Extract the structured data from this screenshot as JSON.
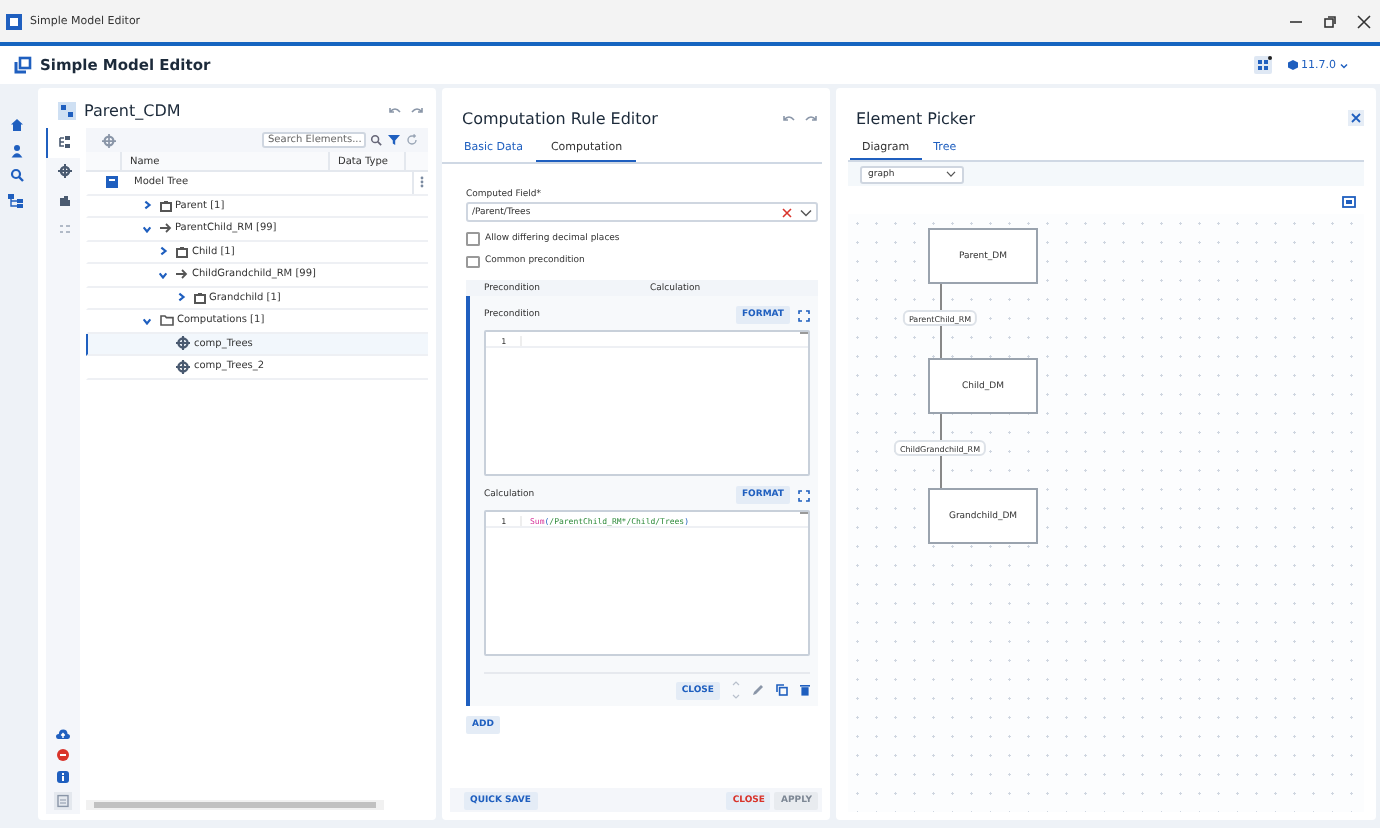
{
  "window": {
    "title": "Simple Model Editor"
  },
  "app_header": {
    "title": "Simple Model Editor",
    "version": "11.7.0"
  },
  "side_tabs": [
    {
      "selected": true
    },
    {
      "selected": false
    },
    {
      "selected": false
    },
    {
      "selected": false
    }
  ],
  "model_panel": {
    "title": "Parent_CDM",
    "search": {
      "placeholder": "Search Elements..."
    },
    "columns": [
      "Name",
      "Data Type"
    ],
    "tree": [
      {
        "label": "Model Tree",
        "kind": "root",
        "selected": false,
        "children": [
          {
            "label": "Parent [1]",
            "kind": "entity",
            "expanded": false,
            "selected": false
          },
          {
            "label": "ParentChild_RM [99]",
            "kind": "relation",
            "expanded": true,
            "selected": false,
            "children": [
              {
                "label": "Child [1]",
                "kind": "entity",
                "expanded": false,
                "selected": false
              },
              {
                "label": "ChildGrandchild_RM [99]",
                "kind": "relation",
                "expanded": true,
                "selected": false,
                "children": [
                  {
                    "label": "Grandchild [1]",
                    "kind": "entity",
                    "expanded": false,
                    "selected": false
                  }
                ]
              }
            ]
          },
          {
            "label": "Computations [1]",
            "kind": "folder",
            "expanded": true,
            "selected": false,
            "children": [
              {
                "label": "comp_Trees",
                "kind": "computation",
                "selected": true
              },
              {
                "label": "comp_Trees_2",
                "kind": "computation",
                "selected": false
              }
            ]
          }
        ]
      }
    ]
  },
  "editor": {
    "title": "Computation Rule Editor",
    "tabs": [
      {
        "label": "Basic Data",
        "selected": false
      },
      {
        "label": "Computation",
        "selected": true
      }
    ],
    "computed_field": {
      "label": "Computed Field*",
      "value": "/Parent/Trees"
    },
    "checkboxes": [
      {
        "label": "Allow differing decimal places",
        "checked": false
      },
      {
        "label": "Common precondition",
        "checked": false
      }
    ],
    "rules_table": {
      "columns": [
        "Precondition",
        "Calculation"
      ],
      "sections": [
        {
          "label": "Precondition",
          "format_button": "FORMAT",
          "lines": [
            {
              "number": "1"
            }
          ]
        },
        {
          "label": "Calculation",
          "format_button": "FORMAT",
          "lines": [
            {
              "number": "1",
              "tokens": [
                {
                  "text": "Sum",
                  "kind": "function"
                },
                {
                  "text": "(",
                  "kind": "paren"
                },
                {
                  "text": "/ParentChild_RM*/Child/Trees",
                  "kind": "path"
                },
                {
                  "text": ")",
                  "kind": "paren"
                }
              ]
            }
          ]
        }
      ],
      "close_button": "CLOSE"
    },
    "add_button": "ADD",
    "footer": {
      "quick_save": "QUICK SAVE",
      "close": "CLOSE",
      "apply": {
        "label": "APPLY",
        "disabled": true
      }
    }
  },
  "picker": {
    "title": "Element Picker",
    "tabs": [
      {
        "label": "Diagram",
        "selected": true
      },
      {
        "label": "Tree",
        "selected": false
      }
    ],
    "view_select": {
      "value": "graph"
    },
    "diagram": {
      "nodes": [
        {
          "label": "Parent_DM"
        },
        {
          "label": "Child_DM"
        },
        {
          "label": "Grandchild_DM"
        }
      ],
      "edges": [
        {
          "label": "ParentChild_RM"
        },
        {
          "label": "ChildGrandchild_RM"
        }
      ]
    }
  }
}
